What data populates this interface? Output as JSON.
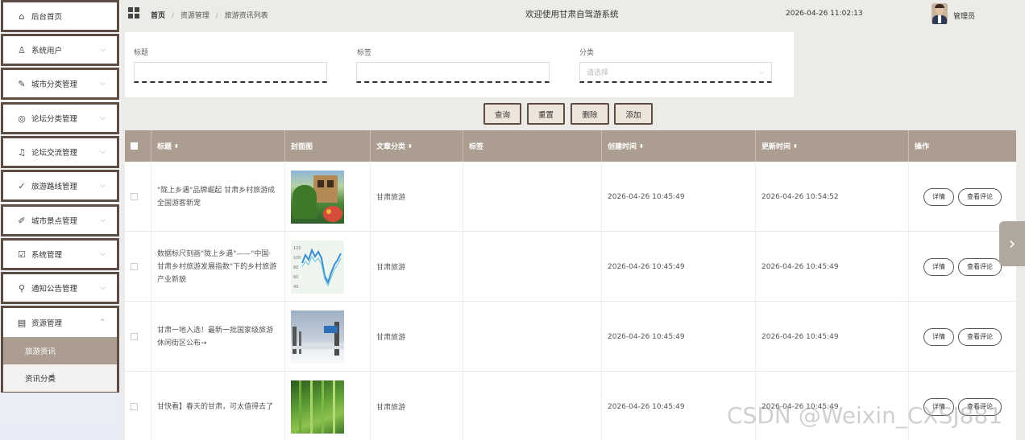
{
  "sidebar": {
    "items": [
      {
        "icon": "home-icon",
        "glyph": "⌂",
        "label": "后台首页",
        "chev": ""
      },
      {
        "icon": "user-icon",
        "glyph": "♙",
        "label": "系统用户",
        "chev": "⌵"
      },
      {
        "icon": "edit-icon",
        "glyph": "✎",
        "label": "城市分类管理",
        "chev": "⌵"
      },
      {
        "icon": "forum-icon",
        "glyph": "◎",
        "label": "论坛分类管理",
        "chev": "⌵"
      },
      {
        "icon": "bell-icon",
        "glyph": "♫",
        "label": "论坛交流管理",
        "chev": "⌵"
      },
      {
        "icon": "route-icon",
        "glyph": "✓",
        "label": "旅游路线管理",
        "chev": "⌵"
      },
      {
        "icon": "pen-icon",
        "glyph": "✐",
        "label": "城市景点管理",
        "chev": "⌵"
      },
      {
        "icon": "check-icon",
        "glyph": "☑",
        "label": "系统管理",
        "chev": "⌵"
      },
      {
        "icon": "clip-icon",
        "glyph": "⚲",
        "label": "通知公告管理",
        "chev": "⌵"
      }
    ],
    "open_menu": {
      "icon": "document-icon",
      "glyph": "▤",
      "label": "资源管理",
      "chev": "⌃",
      "sub_items": [
        {
          "label": "旅游资讯",
          "active": true
        },
        {
          "label": "资讯分类",
          "active": false
        }
      ]
    }
  },
  "header": {
    "breadcrumb_home": "首页",
    "breadcrumb_mid": "资源管理",
    "breadcrumb_last": "旅游资讯列表",
    "sep": "/",
    "welcome": "欢迎使用甘肃自驾游系统",
    "datetime": "2026-04-26 11:02:13",
    "username": "管理员"
  },
  "search": {
    "title_label": "标题",
    "tag_label": "标签",
    "category_label": "分类",
    "category_placeholder": "请选择",
    "category_chevron": "⌵"
  },
  "buttons": {
    "query": "查询",
    "reset": "重置",
    "delete": "删除",
    "add": "添加"
  },
  "table": {
    "headers": {
      "title": "标题",
      "cover": "封面图",
      "category": "文章分类",
      "tags": "标签",
      "created": "创建时间",
      "updated": "更新时间",
      "actions": "操作"
    },
    "sort_glyph": "⬍",
    "detail_label": "详情",
    "comments_label": "查看评论",
    "rows": [
      {
        "title": "\"陇上乡遇\"品牌崛起   甘肃乡村旅游成全国游客新宠",
        "category": "甘肃旅游",
        "tags": "",
        "created": "2026-04-26 10:45:49",
        "updated": "2026-04-26 10:54:52"
      },
      {
        "title": "数据标尺刻画\"陇上乡遇\"——\"中国·甘肃乡村旅游发展指数\"下的乡村旅游产业新貌",
        "category": "甘肃旅游",
        "tags": "",
        "created": "2026-04-26 10:45:49",
        "updated": "2026-04-26 10:45:49"
      },
      {
        "title": "甘肃一地入选！最新一批国家级旅游休闲街区公布→",
        "category": "甘肃旅游",
        "tags": "",
        "created": "2026-04-26 10:45:49",
        "updated": "2026-04-26 10:45:49"
      },
      {
        "title": "甘快看】春天的甘肃，可太值得去了",
        "category": "甘肃旅游",
        "tags": "",
        "created": "2026-04-26 10:45:49",
        "updated": "2026-04-26 10:45:49"
      }
    ],
    "chart_thumb_ticks": [
      "120",
      "100",
      "80",
      "60",
      "40"
    ]
  },
  "watermark": "CSDN @Weixin_CXSJ881",
  "colors": {
    "accent": "#ab9d90",
    "border": "#5d4d42",
    "button_bg": "#ede4da"
  }
}
